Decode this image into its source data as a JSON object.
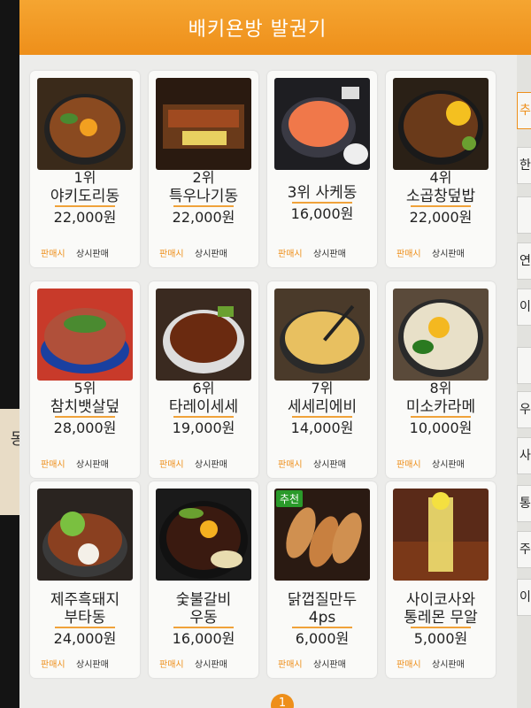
{
  "header": {
    "title": "배키욘방 발권기"
  },
  "left_panel": {
    "label": "동"
  },
  "items": [
    {
      "rank": "1위",
      "name_line1": "야키도리동",
      "name_line2": "",
      "price": "22,000원",
      "tag_sale": "판매시",
      "tag_always": "상시판매",
      "photo": "bowl-chicken"
    },
    {
      "rank": "2위",
      "name_line1": "특우나기동",
      "name_line2": "",
      "price": "22,000원",
      "tag_sale": "판매시",
      "tag_always": "상시판매",
      "photo": "eel-box"
    },
    {
      "rank": "",
      "name_line1": "3위 사케동",
      "name_line2": "",
      "price": "16,000원",
      "tag_sale": "판매시",
      "tag_always": "상시판매",
      "photo": "salmon-bowl"
    },
    {
      "rank": "4위",
      "name_line1": "소곱창덮밥",
      "name_line2": "",
      "price": "22,000원",
      "tag_sale": "판매시",
      "tag_always": "상시판매",
      "photo": "gopchang-bowl"
    },
    {
      "rank": "5위",
      "name_line1": "참치뱃살덮",
      "name_line2": "",
      "price": "28,000원",
      "tag_sale": "판매시",
      "tag_always": "상시판매",
      "photo": "tuna-bowl"
    },
    {
      "rank": "6위",
      "name_line1": "타레이세세",
      "name_line2": "",
      "price": "19,000원",
      "tag_sale": "판매시",
      "tag_always": "상시판매",
      "photo": "tare-bowl"
    },
    {
      "rank": "7위",
      "name_line1": "세세리에비",
      "name_line2": "",
      "price": "14,000원",
      "tag_sale": "판매시",
      "tag_always": "상시판매",
      "photo": "tempura"
    },
    {
      "rank": "8위",
      "name_line1": "미소카라메",
      "name_line2": "",
      "price": "10,000원",
      "tag_sale": "판매시",
      "tag_always": "상시판매",
      "photo": "noodle-bowl"
    },
    {
      "rank": "",
      "name_line1": "제주흑돼지",
      "name_line2": "부타동",
      "price": "24,000원",
      "tag_sale": "판매시",
      "tag_always": "상시판매",
      "photo": "pork-bowl"
    },
    {
      "rank": "",
      "name_line1": "숯불갈비",
      "name_line2": "우동",
      "price": "16,000원",
      "tag_sale": "판매시",
      "tag_always": "상시판매",
      "photo": "galbi-udon"
    },
    {
      "rank": "",
      "name_line1": "닭껍질만두",
      "name_line2": "4ps",
      "price": "6,000원",
      "tag_sale": "판매시",
      "tag_always": "상시판매",
      "photo": "dumplings",
      "badge": "추천"
    },
    {
      "rank": "",
      "name_line1": "사이코사와",
      "name_line2": "통레몬 무알",
      "price": "5,000원",
      "tag_sale": "판매시",
      "tag_always": "상시판매",
      "photo": "lemon-drink"
    }
  ],
  "sidebar": [
    {
      "label": "추"
    },
    {
      "label": "한"
    },
    {
      "label": ""
    },
    {
      "label": "연"
    },
    {
      "label": "이"
    },
    {
      "label": ""
    },
    {
      "label": "우"
    },
    {
      "label": "사"
    },
    {
      "label": "통"
    },
    {
      "label": "주"
    },
    {
      "label": "이"
    }
  ],
  "pagination": {
    "current": "1"
  },
  "colors": {
    "accent": "#ee8f1a",
    "background": "#ececea",
    "card": "#fafaf8"
  }
}
